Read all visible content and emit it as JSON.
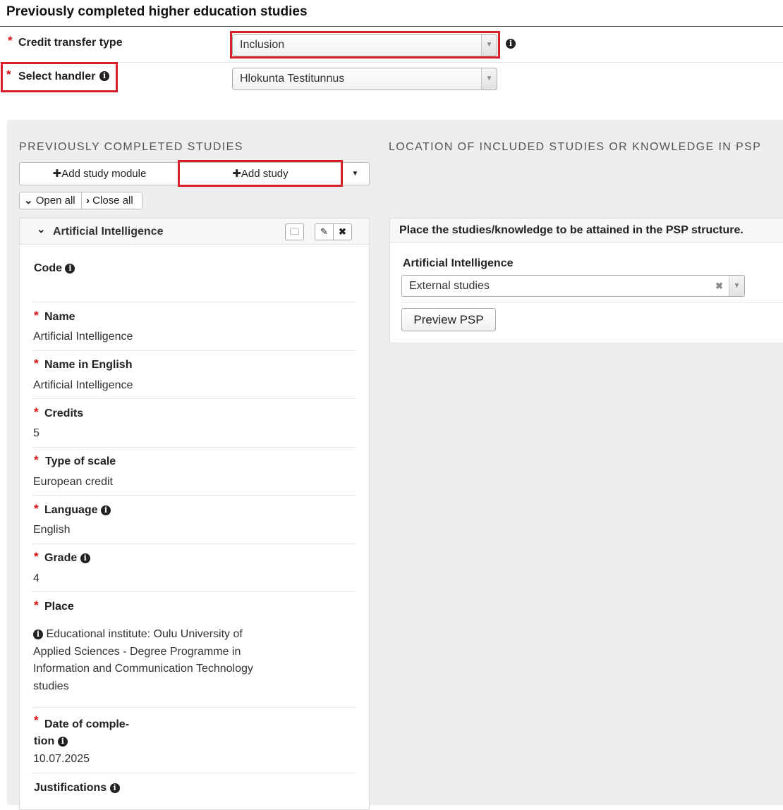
{
  "page": {
    "title": "Previously completed higher education studies"
  },
  "form": {
    "credit_transfer_type": {
      "label": "Credit transfer type",
      "required_mark": "*",
      "value": "Inclusion"
    },
    "select_handler": {
      "label": "Select handler",
      "required_mark": "*",
      "value": "Hlokunta Testitunnus"
    }
  },
  "left": {
    "heading": "PREVIOUSLY COMPLETED STUDIES",
    "add_module_label": "Add study module",
    "add_study_label": "Add study",
    "open_all_label": "Open all",
    "close_all_label": "Close all",
    "study": {
      "title": "Artificial Intelligence",
      "fields": [
        {
          "label": "Code",
          "required": false,
          "info": true,
          "value": ""
        },
        {
          "label": "Name",
          "required": true,
          "info": false,
          "value": "Artificial Intelligence"
        },
        {
          "label": "Name in English",
          "required": true,
          "info": false,
          "value": "Artificial Intelligence"
        },
        {
          "label": "Credits",
          "required": true,
          "info": false,
          "value": "5"
        },
        {
          "label": "Type of scale",
          "required": true,
          "info": false,
          "value": "European credit"
        },
        {
          "label": "Language",
          "required": true,
          "info": true,
          "value": "English"
        },
        {
          "label": "Grade",
          "required": true,
          "info": true,
          "value": "4"
        },
        {
          "label": "Place",
          "required": true,
          "info": false,
          "value_lines": [
            "Educational institute: Oulu University of",
            "Applied Sciences - Degree Programme in",
            "Information and Communication Technology",
            "studies"
          ]
        },
        {
          "label_lines": [
            "Date of comple-",
            "tion"
          ],
          "required": true,
          "info": true,
          "value": "10.07.2025"
        },
        {
          "label": "Justifications",
          "required": false,
          "info": true,
          "value": ""
        }
      ]
    }
  },
  "right": {
    "heading": "LOCATION OF INCLUDED STUDIES OR KNOWLEDGE IN PSP",
    "card_title": "Place the studies/knowledge to be attained in the PSP structure.",
    "study_name": "Artificial Intelligence",
    "placement_value": "External studies",
    "preview_label": "Preview PSP"
  },
  "icons": {
    "info": "info-circle-icon",
    "plus": "plus-icon",
    "chevron": "chevron-down-icon",
    "folder": "folder-icon",
    "edit": "pencil-icon",
    "remove": "close-icon"
  },
  "colors": {
    "highlight": "#d8202a",
    "required": "#dd1111",
    "panel_bg": "#eeeeee"
  }
}
